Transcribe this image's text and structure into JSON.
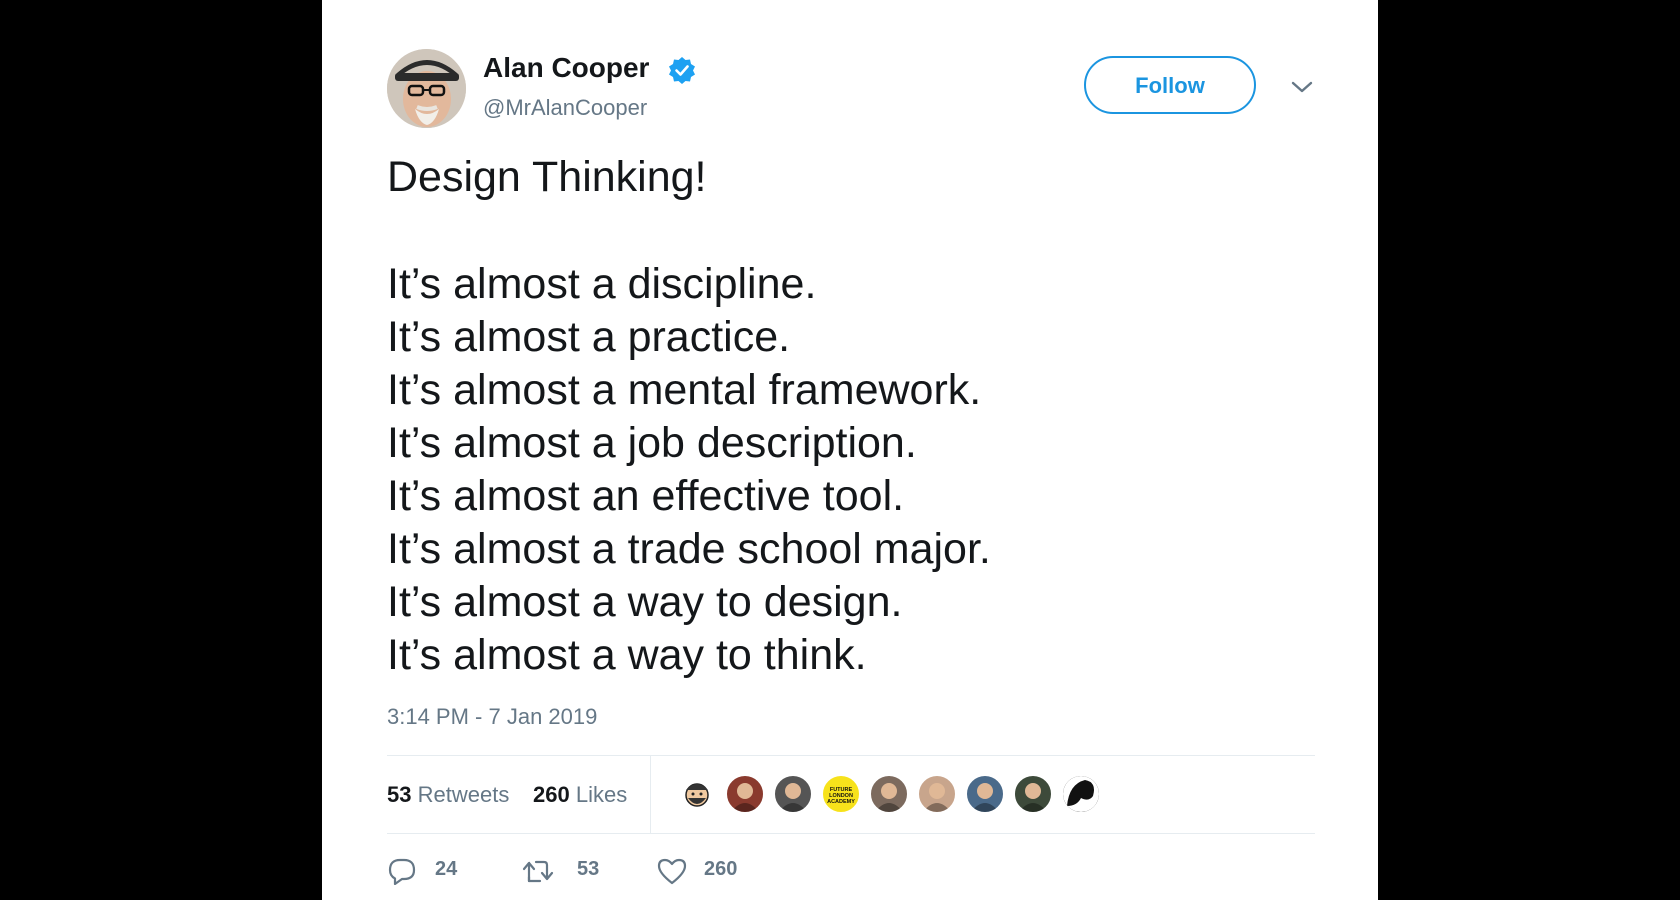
{
  "author": {
    "name": "Alan Cooper",
    "handle": "@MrAlanCooper",
    "verified": true
  },
  "follow_button": {
    "label": "Follow"
  },
  "tweet": {
    "title": "Design Thinking!",
    "lines": [
      "It’s almost a discipline.",
      "It’s almost a practice.",
      "It’s almost a mental framework.",
      "It’s almost a job description.",
      "It’s almost an effective tool.",
      "It’s almost a trade school major.",
      "It’s almost a way to design.",
      "It’s almost a way to think."
    ],
    "timestamp": "3:14 PM - 7 Jan 2019"
  },
  "stats": {
    "retweets_count": "53",
    "retweets_label": "Retweets",
    "likes_count": "260",
    "likes_label": "Likes"
  },
  "liked_by": [
    {
      "icon": "avatar-cartoon-beard",
      "bg": "#ffffff"
    },
    {
      "icon": "avatar-group-photo",
      "bg": "#8a3a2e"
    },
    {
      "icon": "avatar-man-bw",
      "bg": "#555555"
    },
    {
      "icon": "avatar-future-london-academy",
      "bg": "#f7e21b",
      "text": "FUTURE LONDON ACADEMY"
    },
    {
      "icon": "avatar-man-glasses",
      "bg": "#7c6a5e"
    },
    {
      "icon": "avatar-man-smiling",
      "bg": "#c8a58c"
    },
    {
      "icon": "avatar-man-sunglasses",
      "bg": "#4a6a8a"
    },
    {
      "icon": "avatar-woman",
      "bg": "#3d4a3a"
    },
    {
      "icon": "avatar-silhouette",
      "bg": "#111111"
    }
  ],
  "actions": {
    "reply_count": "24",
    "retweet_count": "53",
    "like_count": "260"
  },
  "colors": {
    "accent": "#1b95e0",
    "text": "#14171a",
    "muted": "#657786",
    "divider": "#e6ecf0"
  }
}
